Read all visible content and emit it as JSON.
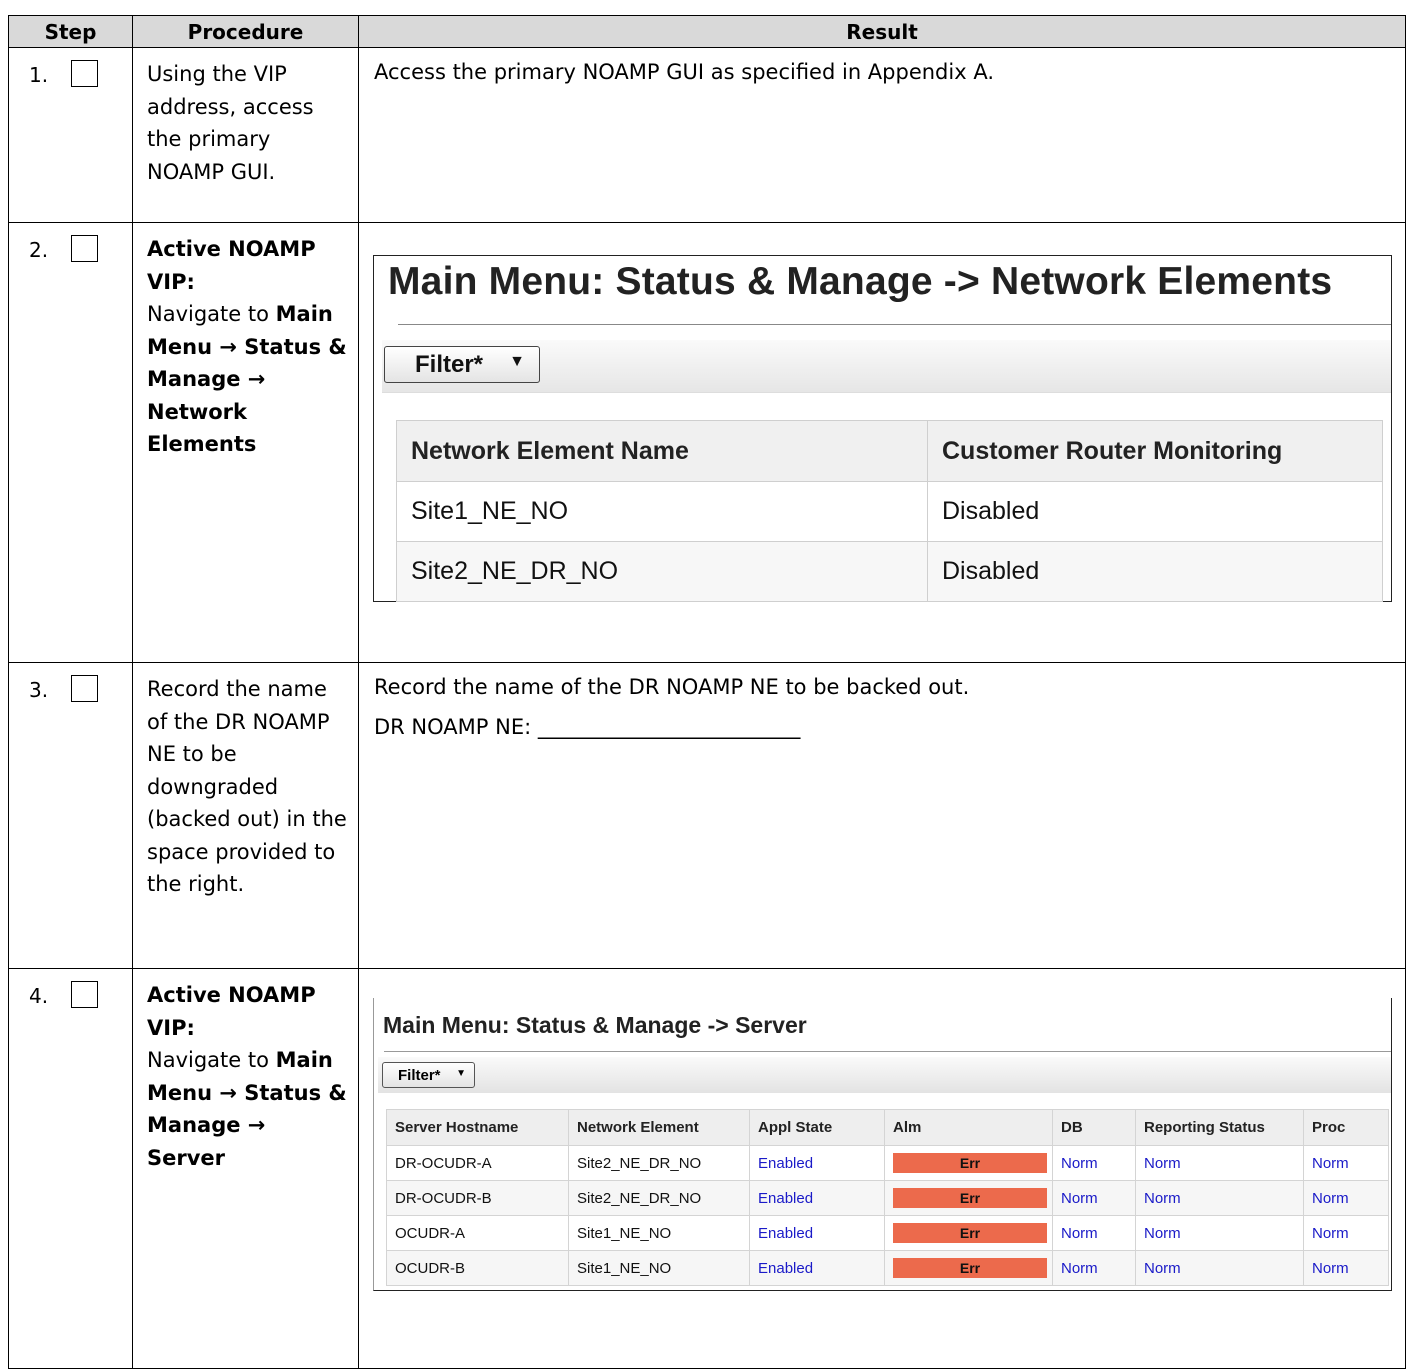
{
  "headers": {
    "step": "Step",
    "procedure": "Procedure",
    "result": "Result"
  },
  "steps": [
    {
      "num": "1.",
      "procedure_text": "Using the VIP address, access the primary NOAMP GUI.",
      "result_text": "Access the primary NOAMP GUI as specified in Appendix A."
    },
    {
      "num": "2.",
      "procedure": {
        "bold_head": "Active NOAMP VIP:",
        "nav_prefix": "Navigate to ",
        "nav_path": "Main Menu → Status & Manage → Network Elements"
      },
      "screenshot": {
        "title": "Main Menu: Status & Manage -> Network Elements",
        "filter_label": "Filter*",
        "columns": [
          "Network Element Name",
          "Customer Router Monitoring"
        ],
        "rows": [
          [
            "Site1_NE_NO",
            "Disabled"
          ],
          [
            "Site2_NE_DR_NO",
            "Disabled"
          ]
        ]
      }
    },
    {
      "num": "3.",
      "procedure_text": "Record the name of the DR NOAMP NE to be downgraded (backed out) in the space provided to the right.",
      "result_text": "Record the name of the DR NOAMP NE to be backed out.",
      "record_field": "DR NOAMP NE: _________________________"
    },
    {
      "num": "4.",
      "procedure": {
        "bold_head": "Active NOAMP VIP:",
        "nav_prefix": "Navigate to ",
        "nav_path": "Main Menu → Status & Manage → Server"
      },
      "screenshot": {
        "title": "Main Menu: Status & Manage -> Server",
        "filter_label": "Filter*",
        "columns": [
          "Server Hostname",
          "Network Element",
          "Appl State",
          "Alm",
          "DB",
          "Reporting Status",
          "Proc"
        ],
        "rows": [
          [
            "DR-OCUDR-A",
            "Site2_NE_DR_NO",
            "Enabled",
            "Err",
            "Norm",
            "Norm",
            "Norm"
          ],
          [
            "DR-OCUDR-B",
            "Site2_NE_DR_NO",
            "Enabled",
            "Err",
            "Norm",
            "Norm",
            "Norm"
          ],
          [
            "OCUDR-A",
            "Site1_NE_NO",
            "Enabled",
            "Err",
            "Norm",
            "Norm",
            "Norm"
          ],
          [
            "OCUDR-B",
            "Site1_NE_NO",
            "Enabled",
            "Err",
            "Norm",
            "Norm",
            "Norm"
          ]
        ]
      }
    }
  ],
  "colors": {
    "header_bg": "#d9d9d9",
    "err_bg": "#ec6a4c",
    "link": "#1a1ac8"
  }
}
